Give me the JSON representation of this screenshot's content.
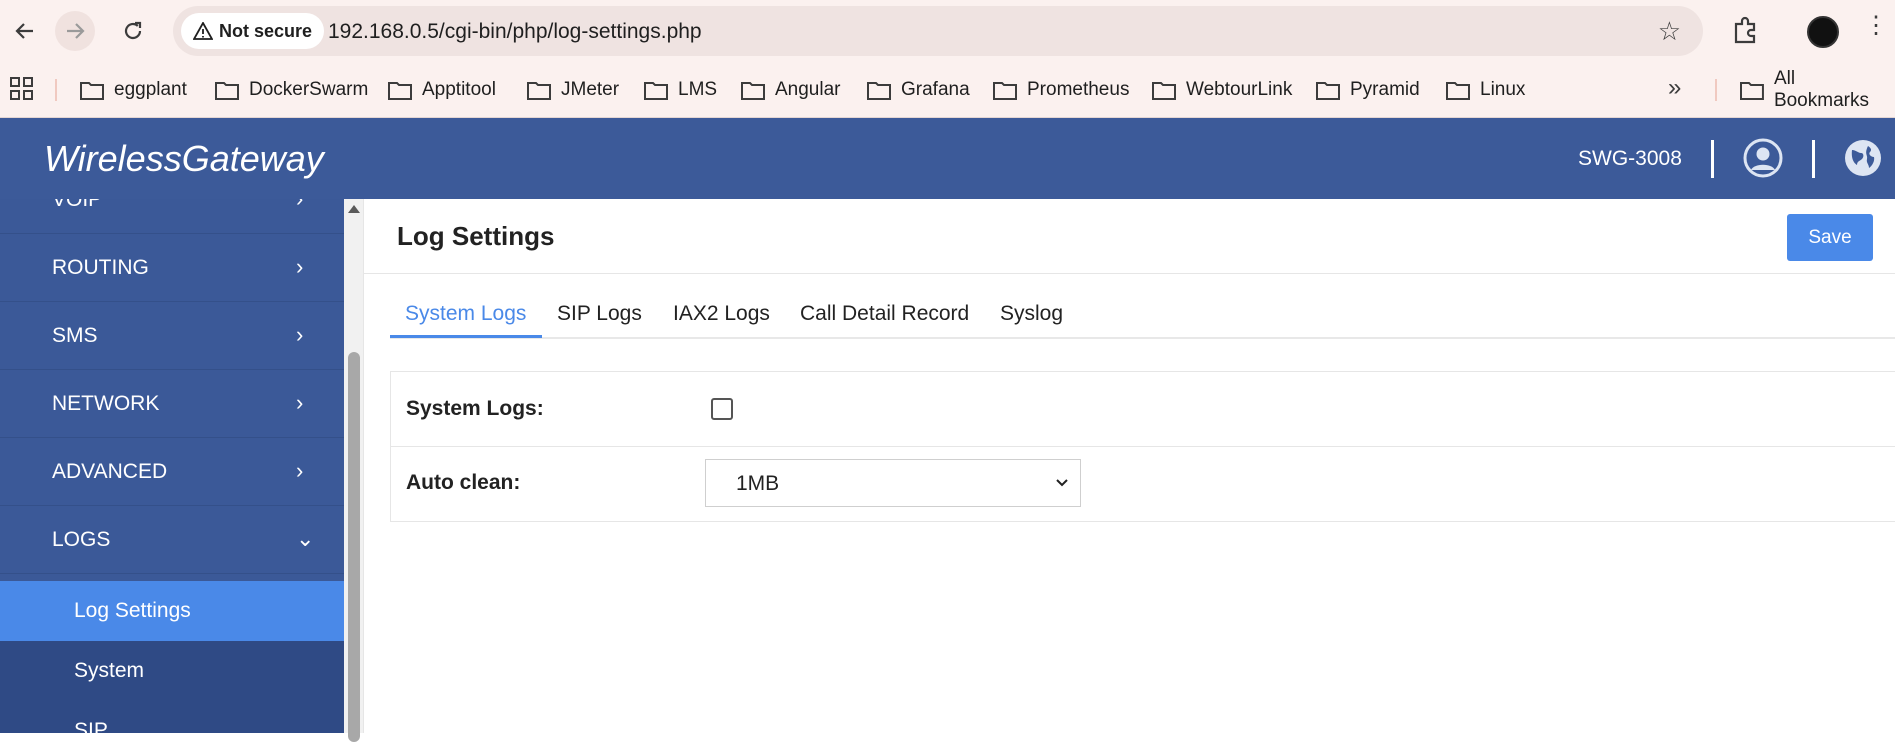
{
  "browser": {
    "security_label": "Not secure",
    "url": "192.168.0.5/cgi-bin/php/log-settings.php",
    "bookmarks": [
      "eggplant",
      "DockerSwarm",
      "Apptitool",
      "JMeter",
      "LMS",
      "Angular",
      "Grafana",
      "Prometheus",
      "WebtourLink",
      "Pyramid",
      "Linux"
    ],
    "all_bookmarks": "All Bookmarks"
  },
  "header": {
    "brand": "WirelessGateway",
    "device": "SWG-3008"
  },
  "sidebar": {
    "items": [
      {
        "label": "VOIP"
      },
      {
        "label": "ROUTING"
      },
      {
        "label": "SMS"
      },
      {
        "label": "NETWORK"
      },
      {
        "label": "ADVANCED"
      },
      {
        "label": "LOGS"
      }
    ],
    "sub_items": [
      {
        "label": "Log Settings"
      },
      {
        "label": "System"
      },
      {
        "label": "SIP"
      }
    ]
  },
  "main": {
    "title": "Log Settings",
    "save_label": "Save",
    "tabs": [
      {
        "label": "System Logs"
      },
      {
        "label": "SIP Logs"
      },
      {
        "label": "IAX2 Logs"
      },
      {
        "label": "Call Detail Record"
      },
      {
        "label": "Syslog"
      }
    ],
    "system_logs_label": "System Logs:",
    "auto_clean_label": "Auto clean:",
    "auto_clean_value": "1MB"
  },
  "colors": {
    "header_bg": "#3c5a99",
    "sidebar_bg": "#3b5998",
    "accent": "#4a89e8"
  }
}
